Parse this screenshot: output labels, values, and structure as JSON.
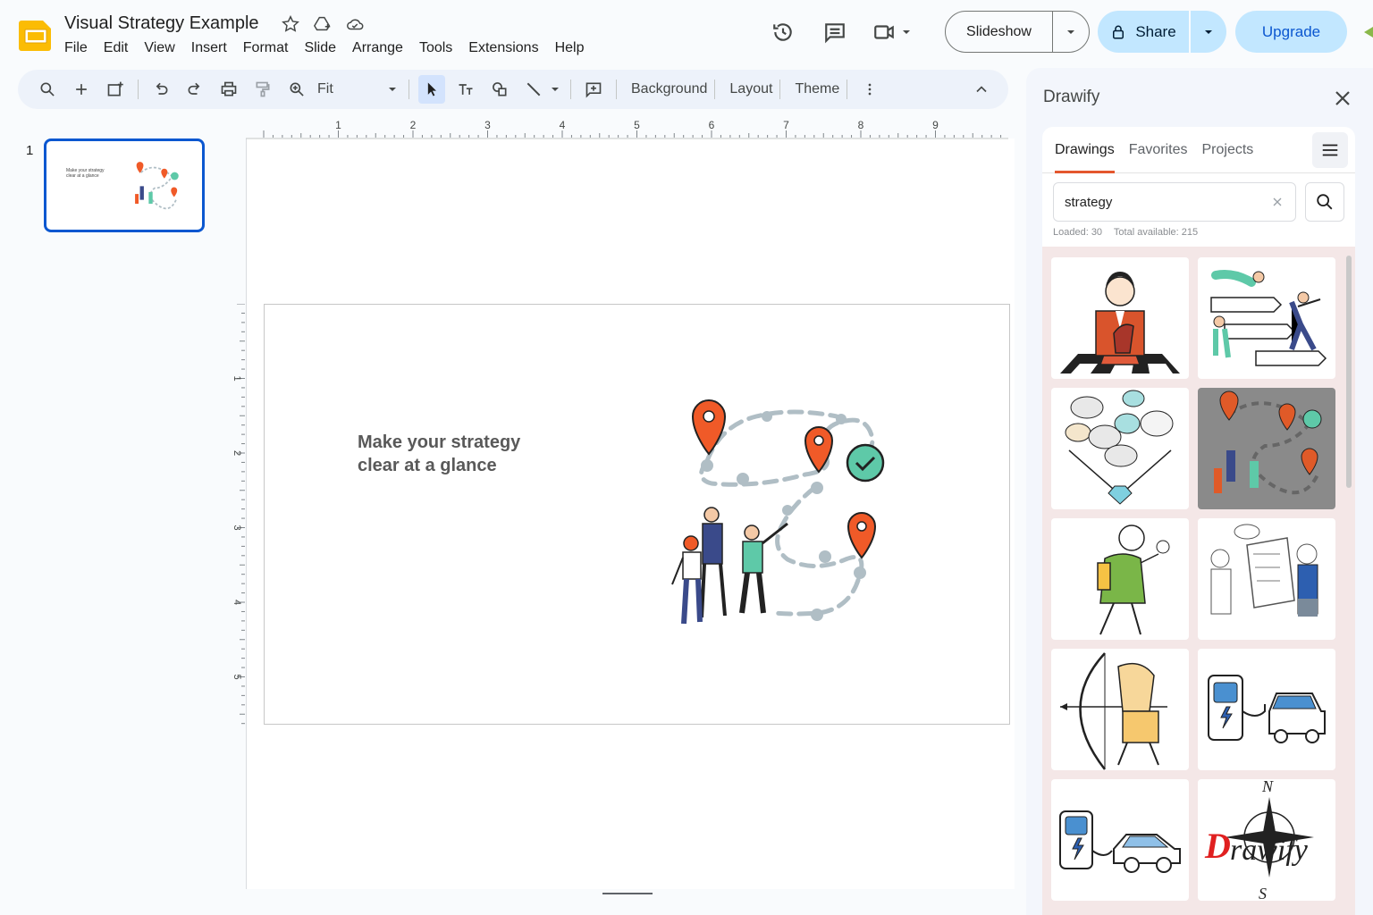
{
  "app": {
    "title": "Visual Strategy Example",
    "menu": [
      "File",
      "Edit",
      "View",
      "Insert",
      "Format",
      "Slide",
      "Arrange",
      "Tools",
      "Extensions",
      "Help"
    ],
    "accent_color": "#fbbc04"
  },
  "header": {
    "slideshow_label": "Slideshow",
    "share_label": "Share",
    "upgrade_label": "Upgrade"
  },
  "toolbar": {
    "zoom_label": "Fit",
    "background_label": "Background",
    "layout_label": "Layout",
    "theme_label": "Theme"
  },
  "ruler": {
    "h_labels": [
      "1",
      "2",
      "3",
      "4",
      "5",
      "6",
      "7",
      "8",
      "9"
    ],
    "v_labels": [
      "1",
      "2",
      "3",
      "4",
      "5"
    ]
  },
  "filmstrip": {
    "slide_number": "1"
  },
  "slide": {
    "text_line1": "Make your strategy",
    "text_line2": "clear at a glance",
    "pin_color": "#f05a28",
    "check_color": "#5ec9a8"
  },
  "side_panel": {
    "title": "Drawify",
    "tabs": [
      "Drawings",
      "Favorites",
      "Projects"
    ],
    "active_tab": "Drawings",
    "search_value": "strategy",
    "loaded_text": "Loaded: 30",
    "total_text": "Total available: 215",
    "tiles": [
      "businessman-chess-drawing",
      "people-signposts-drawing",
      "ideas-diamond-drawing",
      "strategy-path-drawing",
      "person-backpack-drawing",
      "team-whiteboard-drawing",
      "archer-drawing",
      "ev-charger-car-drawing",
      "ev-charger-car-drawing-2",
      "drawify-compass-logo"
    ],
    "logo_text": "Drawify"
  }
}
